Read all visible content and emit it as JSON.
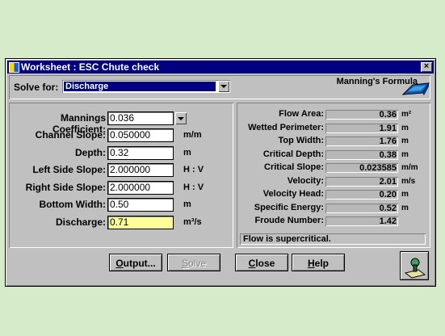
{
  "window": {
    "title": "Worksheet : ESC Chute check",
    "close_label": "×"
  },
  "solve": {
    "label": "Solve for:",
    "selected": "Discharge"
  },
  "formula": {
    "label": "Manning's Formula",
    "icon": "channel-icon"
  },
  "inputs": [
    {
      "label": "Mannings Coefficient:",
      "value": "0.036",
      "unit": "",
      "combo": true
    },
    {
      "label": "Channel Slope:",
      "value": "0.050000",
      "unit": "m/m"
    },
    {
      "label": "Depth:",
      "value": "0.32",
      "unit": "m"
    },
    {
      "label": "Left Side Slope:",
      "value": "2.000000",
      "unit": "H : V"
    },
    {
      "label": "Right Side Slope:",
      "value": "2.000000",
      "unit": "H : V"
    },
    {
      "label": "Bottom Width:",
      "value": "0.50",
      "unit": "m"
    },
    {
      "label": "Discharge:",
      "value": "0.71",
      "unit": "m³/s",
      "highlight": "#ffff99"
    }
  ],
  "outputs": [
    {
      "label": "Flow Area:",
      "value": "0.36",
      "unit": "m²"
    },
    {
      "label": "Wetted Perimeter:",
      "value": "1.91",
      "unit": "m"
    },
    {
      "label": "Top Width:",
      "value": "1.76",
      "unit": "m"
    },
    {
      "label": "Critical Depth:",
      "value": "0.38",
      "unit": "m"
    },
    {
      "label": "Critical Slope:",
      "value": "0.023585",
      "unit": "m/m"
    },
    {
      "label": "Velocity:",
      "value": "2.01",
      "unit": "m/s"
    },
    {
      "label": "Velocity Head:",
      "value": "0.20",
      "unit": "m"
    },
    {
      "label": "Specific Energy:",
      "value": "0.52",
      "unit": "m"
    },
    {
      "label": "Froude Number:",
      "value": "1.42",
      "unit": ""
    }
  ],
  "status_message": "Flow is supercritical.",
  "buttons": [
    {
      "label": "Output...",
      "accel": "O",
      "enabled": true
    },
    {
      "label": "Solve",
      "accel": "S",
      "enabled": false
    },
    {
      "label": "Close",
      "accel": "C",
      "enabled": true
    },
    {
      "label": "Help",
      "accel": "H",
      "enabled": true
    }
  ],
  "colors": {
    "background": "#d6ebc9",
    "titlebar": "#000080",
    "face": "#c0c0c0"
  }
}
